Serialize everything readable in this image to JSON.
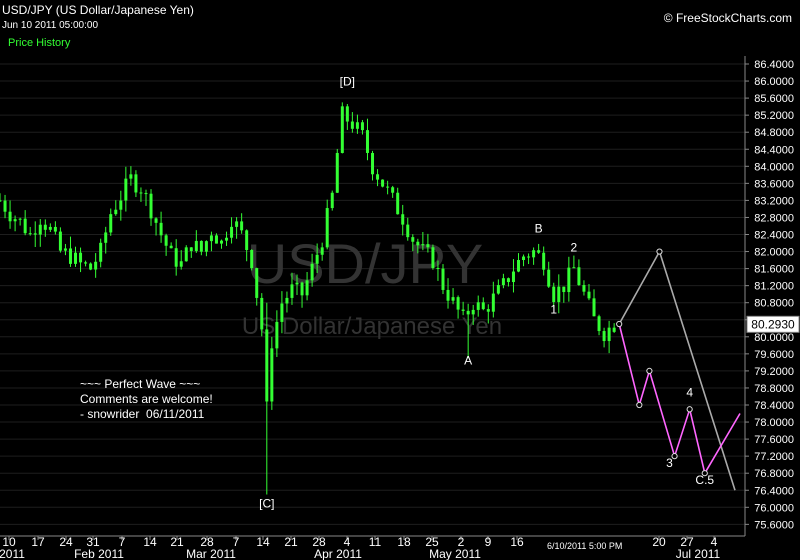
{
  "header": {
    "title": "USD/JPY (US Dollar/Japanese Yen)",
    "timestamp": "Jun 10 2011 05:00:00",
    "legend": "Price History",
    "brand": "© FreeStockCharts.com"
  },
  "watermark": {
    "symbol": "USD/JPY",
    "name": "US Dollar/Japanese Yen"
  },
  "note": [
    "~~~ Perfect Wave ~~~",
    "Comments are welcome!",
    "- snowrider  06/11/2011"
  ],
  "last_date_label": "6/10/2011 5:00 PM",
  "colors": {
    "candle": "#33ff33",
    "projection": "#ff66ff",
    "target_line": "#aaaaaa",
    "background": "#000000"
  },
  "chart_data": {
    "type": "candlestick",
    "ylim": [
      75.4,
      86.6
    ],
    "yticks": [
      "86.4000",
      "86.0000",
      "85.6000",
      "85.2000",
      "84.8000",
      "84.4000",
      "84.0000",
      "83.6000",
      "83.2000",
      "82.8000",
      "82.4000",
      "82.0000",
      "81.6000",
      "81.2000",
      "80.8000",
      "80.4000",
      "80.0000",
      "79.6000",
      "79.2000",
      "78.8000",
      "78.4000",
      "78.0000",
      "77.6000",
      "77.2000",
      "76.8000",
      "76.4000",
      "76.0000",
      "75.6000"
    ],
    "xticks": [
      "10",
      "17",
      "24",
      "31",
      "7",
      "14",
      "21",
      "28",
      "7",
      "14",
      "21",
      "28",
      "4",
      "11",
      "18",
      "25",
      "2",
      "9",
      "16",
      "20",
      "27",
      "4"
    ],
    "month_labels": [
      "2011",
      "Feb 2011",
      "Mar 2011",
      "Apr 2011",
      "May 2011",
      "Jul 2011"
    ],
    "last_price": "80.2930",
    "price_path": [
      {
        "t": 0,
        "p": 83.2
      },
      {
        "t": 2,
        "p": 82.9
      },
      {
        "t": 4,
        "p": 82.7
      },
      {
        "t": 6,
        "p": 82.4
      },
      {
        "t": 8,
        "p": 82.8
      },
      {
        "t": 10,
        "p": 82.5
      },
      {
        "t": 12,
        "p": 82.0
      },
      {
        "t": 14,
        "p": 81.9
      },
      {
        "t": 16,
        "p": 81.7
      },
      {
        "t": 18,
        "p": 81.6
      },
      {
        "t": 20,
        "p": 82.0
      },
      {
        "t": 22,
        "p": 82.9
      },
      {
        "t": 24,
        "p": 83.3
      },
      {
        "t": 26,
        "p": 83.7
      },
      {
        "t": 28,
        "p": 83.5
      },
      {
        "t": 30,
        "p": 83.0
      },
      {
        "t": 32,
        "p": 82.4
      },
      {
        "t": 34,
        "p": 81.9
      },
      {
        "t": 36,
        "p": 81.7
      },
      {
        "t": 38,
        "p": 82.2
      },
      {
        "t": 40,
        "p": 82.0
      },
      {
        "t": 42,
        "p": 82.5
      },
      {
        "t": 44,
        "p": 82.2
      },
      {
        "t": 46,
        "p": 82.8
      },
      {
        "t": 48,
        "p": 82.4
      },
      {
        "t": 50,
        "p": 81.8
      },
      {
        "t": 52,
        "p": 80.2
      },
      {
        "t": 53,
        "p": 78.3
      },
      {
        "t": 54,
        "p": 79.9
      },
      {
        "t": 56,
        "p": 80.8
      },
      {
        "t": 58,
        "p": 81.1
      },
      {
        "t": 60,
        "p": 81.0
      },
      {
        "t": 62,
        "p": 81.6
      },
      {
        "t": 64,
        "p": 82.3
      },
      {
        "t": 66,
        "p": 83.3
      },
      {
        "t": 67,
        "p": 84.3
      },
      {
        "t": 68,
        "p": 85.2
      },
      {
        "t": 70,
        "p": 85.0
      },
      {
        "t": 72,
        "p": 84.7
      },
      {
        "t": 74,
        "p": 84.0
      },
      {
        "t": 76,
        "p": 83.6
      },
      {
        "t": 78,
        "p": 83.2
      },
      {
        "t": 80,
        "p": 82.8
      },
      {
        "t": 82,
        "p": 82.3
      },
      {
        "t": 84,
        "p": 82.0
      },
      {
        "t": 86,
        "p": 81.8
      },
      {
        "t": 88,
        "p": 81.2
      },
      {
        "t": 90,
        "p": 80.8
      },
      {
        "t": 92,
        "p": 80.4
      },
      {
        "t": 94,
        "p": 80.8
      },
      {
        "t": 96,
        "p": 80.6
      },
      {
        "t": 98,
        "p": 80.9
      },
      {
        "t": 100,
        "p": 81.2
      },
      {
        "t": 102,
        "p": 81.6
      },
      {
        "t": 104,
        "p": 81.9
      },
      {
        "t": 106,
        "p": 82.0
      },
      {
        "t": 108,
        "p": 81.8
      },
      {
        "t": 110,
        "p": 81.0
      },
      {
        "t": 112,
        "p": 81.2
      },
      {
        "t": 114,
        "p": 81.6
      },
      {
        "t": 116,
        "p": 81.0
      },
      {
        "t": 118,
        "p": 80.4
      },
      {
        "t": 120,
        "p": 80.1
      },
      {
        "t": 122,
        "p": 80.3
      }
    ],
    "wick_extremes": [
      {
        "t": 53,
        "low": 76.3,
        "high": 80.8
      },
      {
        "t": 68,
        "high": 85.5
      },
      {
        "t": 93,
        "low": 79.5
      }
    ],
    "projection_path": [
      {
        "t": 123,
        "p": 80.3
      },
      {
        "t": 127,
        "p": 78.4
      },
      {
        "t": 129,
        "p": 79.2
      },
      {
        "t": 134,
        "p": 77.2
      },
      {
        "t": 137,
        "p": 78.3
      },
      {
        "t": 140,
        "p": 76.8
      },
      {
        "t": 147,
        "p": 78.2
      }
    ],
    "target_path": [
      {
        "t": 123,
        "p": 80.3
      },
      {
        "t": 131,
        "p": 82.0
      },
      {
        "t": 146,
        "p": 76.4
      }
    ],
    "wave_labels": [
      {
        "text": "[D]",
        "t": 69,
        "p": 85.9
      },
      {
        "text": "[C]",
        "t": 53,
        "p": 76.0
      },
      {
        "text": "A",
        "t": 93,
        "p": 79.35
      },
      {
        "text": "B",
        "t": 107,
        "p": 82.45
      },
      {
        "text": "1",
        "t": 110,
        "p": 80.55
      },
      {
        "text": "2",
        "t": 114,
        "p": 82.0
      },
      {
        "text": "3",
        "t": 133,
        "p": 76.95
      },
      {
        "text": "4",
        "t": 137,
        "p": 78.6
      },
      {
        "text": "C.5",
        "t": 140,
        "p": 76.55
      }
    ]
  }
}
